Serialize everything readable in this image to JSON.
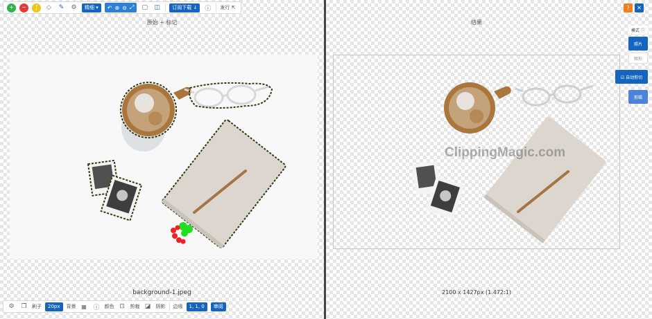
{
  "toolbar_top": {
    "mode_label": "精细 ▾",
    "download_label": "订阅下载 ↓",
    "publish_label": "发行 ⇱"
  },
  "left_pane": {
    "title": "原始 + 标记",
    "filename": "background-1.jpeg"
  },
  "right_pane": {
    "title": "结果",
    "dimensions": "2100 x 1427px (1.472:1)",
    "watermark": "ClippingMagic.com"
  },
  "bottom_toolbar": {
    "brush_label": "刷子",
    "brush_size": "20px",
    "background_label": "背景",
    "color_label": "颜色",
    "crop_label": "剪裁",
    "shadow_label": "阴影",
    "margin_label": "边缘",
    "margin_value": "1, 1, 0",
    "apply_label": "审阅"
  },
  "sidebar": {
    "mode_label": "模式 ⓘ",
    "photo_label": "照片",
    "graphic_label": "图形",
    "auto_clip_label": "☑ 自动剪切",
    "clip_label": "剪辑"
  },
  "colors": {
    "accent": "#1565c0",
    "zoom_group": "#2e7fd6",
    "divider": "#444444",
    "keep_marker": "#22dd22",
    "remove_marker": "#ee2222",
    "help_badge": "#f57c1f"
  },
  "icons": {
    "keep": "plus-circle-icon",
    "remove": "minus-circle-icon",
    "hair": "hair-icon",
    "eraser": "eraser-icon",
    "scalpel": "scalpel-icon",
    "settings": "settings-icon",
    "undo": "undo-icon",
    "zoom_in": "zoom-in-icon",
    "zoom_out": "zoom-out-icon",
    "fit": "fit-icon",
    "view_single": "view-single-icon",
    "view_split": "view-split-icon",
    "info": "info-icon",
    "help": "help-icon",
    "close": "close-icon"
  }
}
